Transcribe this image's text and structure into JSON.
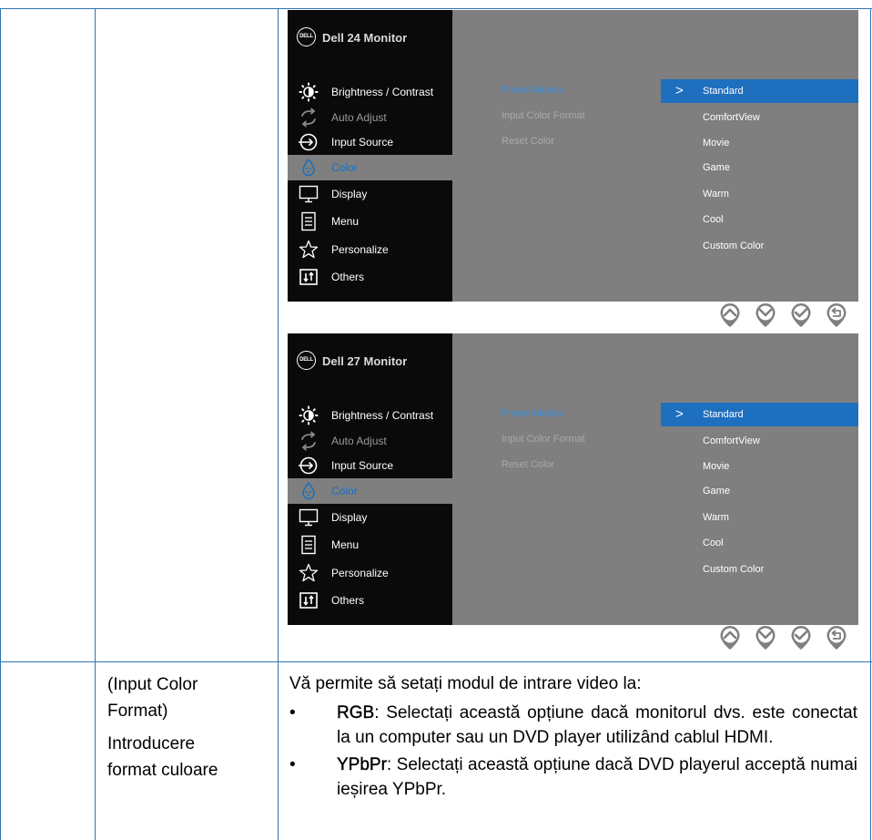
{
  "osd_panels": [
    {
      "title": "Dell 24 Monitor",
      "logo_text": "DELL",
      "menu": [
        {
          "label": "Brightness / Contrast",
          "icon": "brightness-icon",
          "state": "normal"
        },
        {
          "label": "Auto Adjust",
          "icon": "auto-adjust-icon",
          "state": "dim"
        },
        {
          "label": "Input Source",
          "icon": "input-source-icon",
          "state": "normal"
        },
        {
          "label": "Color",
          "icon": "color-icon",
          "state": "active"
        },
        {
          "label": "Display",
          "icon": "display-icon",
          "state": "normal"
        },
        {
          "label": "Menu",
          "icon": "menu-icon",
          "state": "normal"
        },
        {
          "label": "Personalize",
          "icon": "personalize-icon",
          "state": "normal"
        },
        {
          "label": "Others",
          "icon": "others-icon",
          "state": "normal"
        }
      ],
      "submenu": [
        "Preset Modes",
        "Input Color Format",
        "Reset Color"
      ],
      "options": [
        "Standard",
        "ComfortView",
        "Movie",
        "Game",
        "Warm",
        "Cool",
        "Custom Color"
      ],
      "selected_arrow": ">"
    },
    {
      "title": "Dell 27 Monitor",
      "logo_text": "DELL",
      "menu": [
        {
          "label": "Brightness / Contrast",
          "icon": "brightness-icon",
          "state": "normal"
        },
        {
          "label": "Auto Adjust",
          "icon": "auto-adjust-icon",
          "state": "dim"
        },
        {
          "label": "Input Source",
          "icon": "input-source-icon",
          "state": "normal"
        },
        {
          "label": "Color",
          "icon": "color-icon",
          "state": "active"
        },
        {
          "label": "Display",
          "icon": "display-icon",
          "state": "normal"
        },
        {
          "label": "Menu",
          "icon": "menu-icon",
          "state": "normal"
        },
        {
          "label": "Personalize",
          "icon": "personalize-icon",
          "state": "normal"
        },
        {
          "label": "Others",
          "icon": "others-icon",
          "state": "normal"
        }
      ],
      "submenu": [
        "Preset Modes",
        "Input Color Format",
        "Reset Color"
      ],
      "options": [
        "Standard",
        "ComfortView",
        "Movie",
        "Game",
        "Warm",
        "Cool",
        "Custom Color"
      ],
      "selected_arrow": ">"
    }
  ],
  "nav_buttons": [
    "up-icon",
    "down-icon",
    "check-icon",
    "back-icon"
  ],
  "row2": {
    "name_line1": "(Input  Color",
    "name_line2": "Format)",
    "name_line3": "Introducere",
    "name_line4": "format culoare",
    "intro": "Vă permite să setați modul de intrare video la:",
    "bullet_symbol": "•",
    "bullets": [
      {
        "term": "RGB",
        "text": ": Selectați această opțiune dacă monitorul dvs. este conectat la un computer sau un DVD player utilizând cablul HDMI."
      },
      {
        "term": "YPbPr",
        "text": ": Selectați această opțiune dacă DVD playerul acceptă numai ieșirea YPbPr."
      }
    ]
  },
  "colors": {
    "table_border": "#2e75b6",
    "osd_black": "#0a0a0a",
    "osd_gray": "#7f7f7f",
    "selection_blue": "#1f6fbf",
    "active_text_blue": "#1a6fbf"
  }
}
